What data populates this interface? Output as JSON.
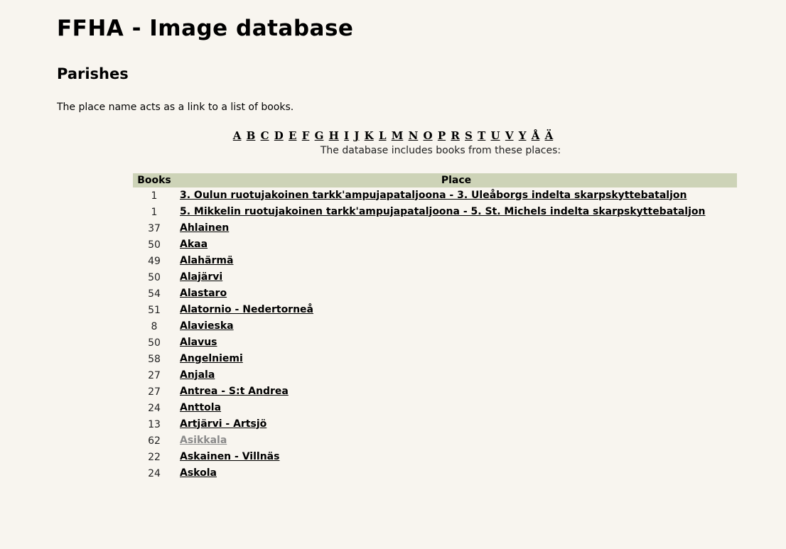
{
  "header": {
    "title": "FFHA - Image database",
    "subtitle": "Parishes",
    "intro": "The place name acts as a link to a list of books."
  },
  "alphabet": [
    "A",
    "B",
    "C",
    "D",
    "E",
    "F",
    "G",
    "H",
    "I",
    "J",
    "K",
    "L",
    "M",
    "N",
    "O",
    "P",
    "R",
    "S",
    "T",
    "U",
    "V",
    "Y",
    "Å",
    "Ä"
  ],
  "caption": "The database includes books from these places:",
  "table": {
    "columns": [
      "Books",
      "Place"
    ],
    "rows": [
      {
        "books": "1",
        "place": "3. Oulun ruotujakoinen tarkk'ampujapataljoona - 3. Uleåborgs indelta skarpskyttebataljon",
        "visited": false
      },
      {
        "books": "1",
        "place": "5. Mikkelin ruotujakoinen tarkk'ampujapataljoona - 5. St. Michels indelta skarpskyttebataljon",
        "visited": false
      },
      {
        "books": "37",
        "place": "Ahlainen",
        "visited": false
      },
      {
        "books": "50",
        "place": "Akaa",
        "visited": false
      },
      {
        "books": "49",
        "place": "Alahärmä",
        "visited": false
      },
      {
        "books": "50",
        "place": "Alajärvi",
        "visited": false
      },
      {
        "books": "54",
        "place": "Alastaro",
        "visited": false
      },
      {
        "books": "51",
        "place": "Alatornio - Nedertorneå",
        "visited": false
      },
      {
        "books": "8",
        "place": "Alavieska",
        "visited": false
      },
      {
        "books": "50",
        "place": "Alavus",
        "visited": false
      },
      {
        "books": "58",
        "place": "Angelniemi",
        "visited": false
      },
      {
        "books": "27",
        "place": "Anjala",
        "visited": false
      },
      {
        "books": "27",
        "place": "Antrea - S:t Andrea",
        "visited": false
      },
      {
        "books": "24",
        "place": "Anttola",
        "visited": false
      },
      {
        "books": "13",
        "place": "Artjärvi - Artsjö",
        "visited": false
      },
      {
        "books": "62",
        "place": "Asikkala",
        "visited": true
      },
      {
        "books": "22",
        "place": "Askainen - Villnäs",
        "visited": false
      },
      {
        "books": "24",
        "place": "Askola",
        "visited": false
      }
    ]
  }
}
